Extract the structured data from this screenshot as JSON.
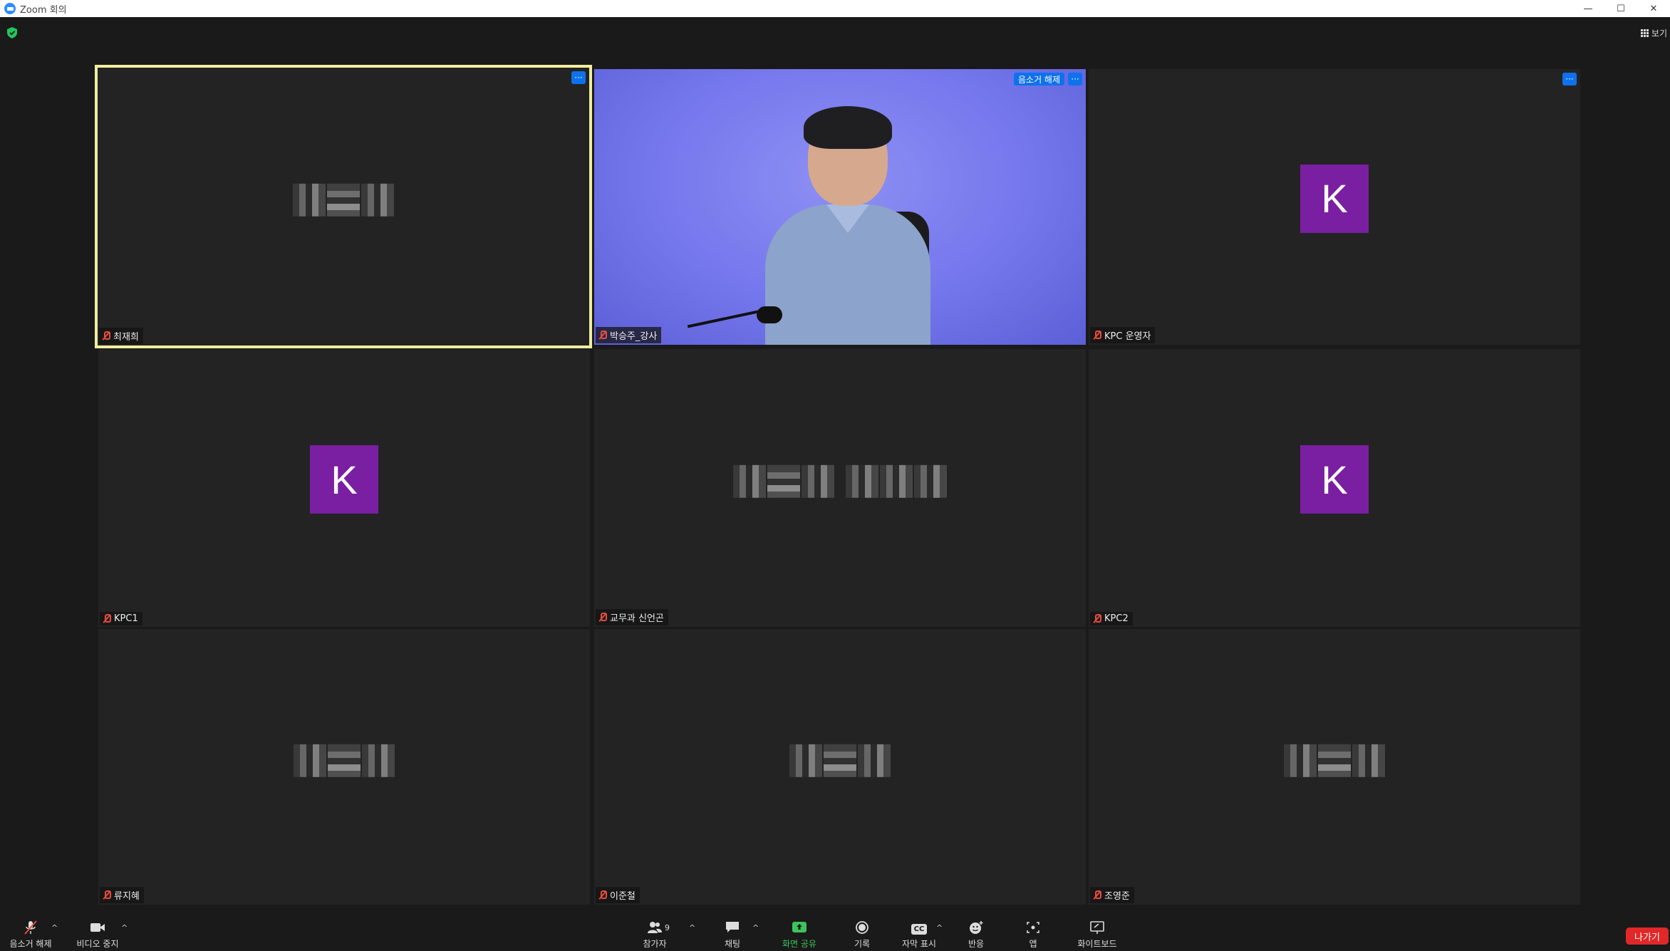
{
  "window": {
    "title": "Zoom 회의",
    "minimize": "—",
    "maximize": "☐",
    "close": "✕"
  },
  "view": {
    "label": "보기"
  },
  "tiles": [
    {
      "name": "최재희",
      "type": "pixel"
    },
    {
      "name": "박승주_강사",
      "type": "video",
      "unmute_label": "음소거 해제"
    },
    {
      "name": "KPC 운영자",
      "type": "avatar",
      "avatar_letter": "K"
    },
    {
      "name": "KPC1",
      "type": "avatar",
      "avatar_letter": "K"
    },
    {
      "name": "교무과 신언곤",
      "type": "pixel"
    },
    {
      "name": "KPC2",
      "type": "avatar",
      "avatar_letter": "K"
    },
    {
      "name": "류지혜",
      "type": "pixel"
    },
    {
      "name": "이준철",
      "type": "pixel"
    },
    {
      "name": "조영준",
      "type": "pixel"
    }
  ],
  "more_label": "···",
  "toolbar": {
    "unmute": "음소거 해제",
    "stop_video": "비디오 중지",
    "participants": "참가자",
    "participants_count": "9",
    "chat": "채팅",
    "share_screen": "화면 공유",
    "record": "기록",
    "captions": "자막 표시",
    "captions_icon": "CC",
    "reactions": "반응",
    "apps": "앱",
    "whiteboard": "화이트보드",
    "leave": "나가기",
    "caret": "^"
  },
  "colors": {
    "accent": "#0e72ed",
    "active_border": "#f0eea0",
    "avatar": "#7a1fa2",
    "leave": "#e02828",
    "share": "#3ec45a"
  }
}
